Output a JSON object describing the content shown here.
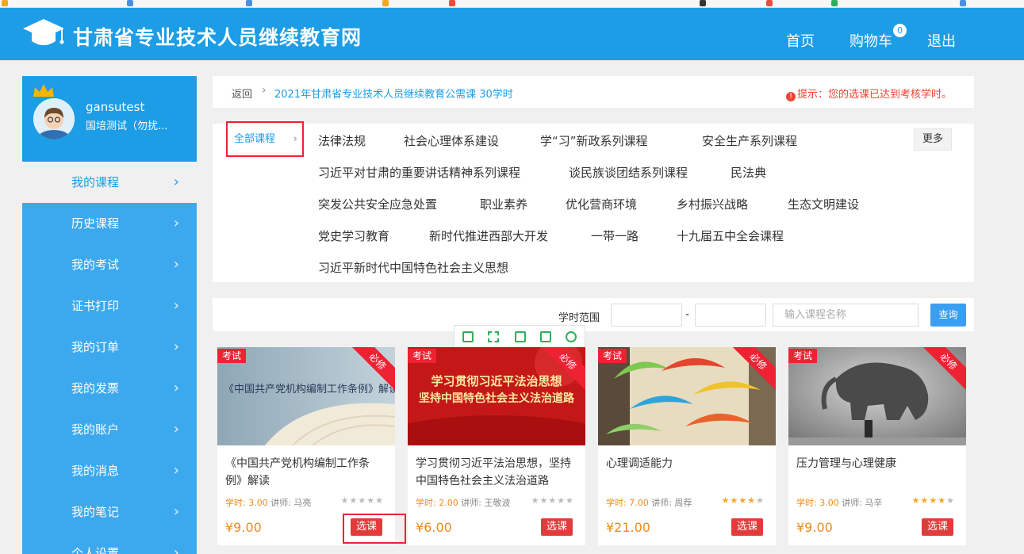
{
  "header": {
    "site_title": "甘肃省专业技术人员继续教育网",
    "nav_home": "首页",
    "nav_cart": "购物车",
    "cart_count": "0",
    "nav_logout": "退出"
  },
  "user": {
    "name": "gansutest",
    "org": "国培测试（勿扰..."
  },
  "sidebar": {
    "items": [
      {
        "label": "我的课程"
      },
      {
        "label": "历史课程"
      },
      {
        "label": "我的考试"
      },
      {
        "label": "证书打印"
      },
      {
        "label": "我的订单"
      },
      {
        "label": "我的发票"
      },
      {
        "label": "我的账户"
      },
      {
        "label": "我的消息"
      },
      {
        "label": "我的笔记"
      },
      {
        "label": "个人设置"
      }
    ]
  },
  "breadcrumb": {
    "back": "返回",
    "current": "2021年甘肃省专业技术人员继续教育公需课  30学时",
    "notice": "提示：您的选课已达到考核学时。"
  },
  "categories": {
    "all": "全部课程",
    "more": "更多",
    "items": [
      "法律法规",
      "社会心理体系建设",
      "学“习”新政系列课程",
      "安全生产系列课程",
      "习近平对甘肃的重要讲话精神系列课程",
      "谈民族谈团结系列课程",
      "民法典",
      "突发公共安全应急处置",
      "职业素养",
      "优化营商环境",
      "乡村振兴战略",
      "生态文明建设",
      "党史学习教育",
      "新时代推进西部大开发",
      "一带一路",
      "十九届五中全会课程",
      "习近平新时代中国特色社会主义思想"
    ]
  },
  "filter": {
    "label": "学时范围",
    "dash": "-",
    "search_placeholder": "输入课程名称",
    "query_button": "查询"
  },
  "courses": [
    {
      "tag": "考试",
      "required": "必修",
      "thumb_text": "《中国共产党机构编制工作条例》解读",
      "title": "《中国共产党机构编制工作条例》解读",
      "hours_label": "学时: 3.00",
      "teacher": "讲师: 马亮",
      "stars": "★★★★★",
      "price": "¥9.00",
      "action": "选课",
      "rating": 0
    },
    {
      "tag": "考试",
      "required": "必修",
      "thumb_text_1": "学习贯彻习近平法治思想",
      "thumb_text_2": "坚持中国特色社会主义法治道路",
      "title": "学习贯彻习近平法治思想，坚持中国特色社会主义法治道路",
      "hours_label": "学时: 2.00",
      "teacher": "讲师: 王敬波",
      "stars": "★★★★★",
      "price": "¥6.00",
      "action": "选课",
      "rating": 0
    },
    {
      "tag": "考试",
      "required": "必修",
      "title": "心理调适能力",
      "hours_label": "学时: 7.00",
      "teacher": "讲师: 周荐",
      "stars": "★★★★★",
      "price": "¥21.00",
      "action": "选课",
      "rating": 4
    },
    {
      "tag": "考试",
      "required": "必修",
      "title": "压力管理与心理健康",
      "hours_label": "学时: 3.00",
      "teacher": "讲师: 马辛",
      "stars": "★★★★★",
      "price": "¥9.00",
      "action": "选课",
      "rating": 4
    }
  ],
  "colors": {
    "primary": "#1c9de6",
    "sidebar": "#3ca9ef",
    "danger": "#e23b3b",
    "price": "#f08a1c"
  }
}
